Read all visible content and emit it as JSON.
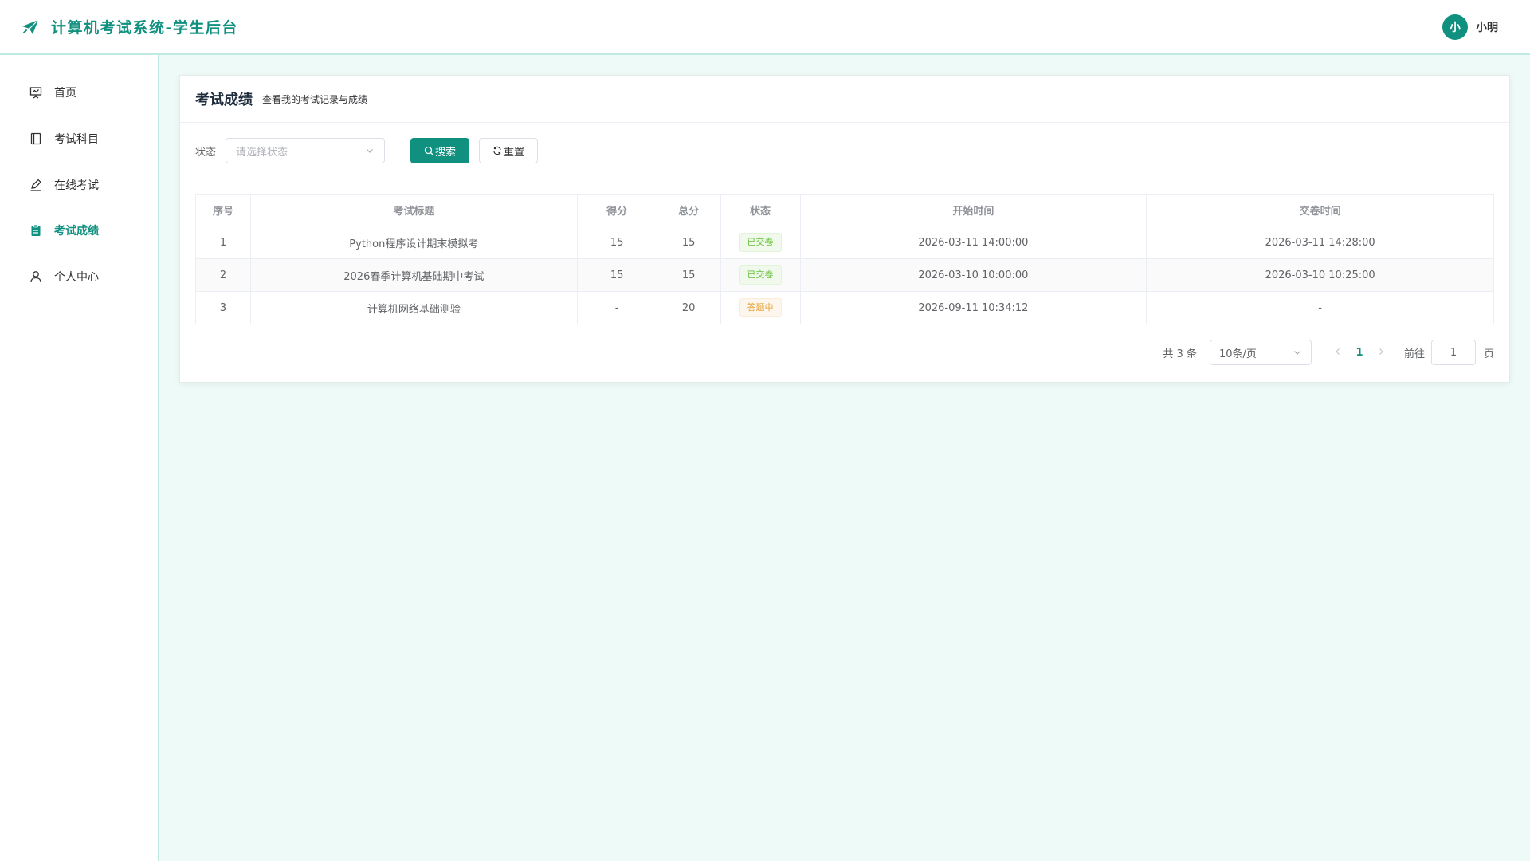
{
  "app": {
    "title": "计算机考试系统-学生后台",
    "user": {
      "avatar_text": "小",
      "name": "小明"
    }
  },
  "sidebar": {
    "items": [
      {
        "label": "首页",
        "icon": "presentation-icon",
        "active": false
      },
      {
        "label": "考试科目",
        "icon": "notebook-icon",
        "active": false
      },
      {
        "label": "在线考试",
        "icon": "edit-pen-icon",
        "active": false
      },
      {
        "label": "考试成绩",
        "icon": "clipboard-icon",
        "active": true
      },
      {
        "label": "个人中心",
        "icon": "user-icon",
        "active": false
      }
    ]
  },
  "page": {
    "title": "考试成绩",
    "subtitle": "查看我的考试记录与成绩"
  },
  "filter": {
    "status_label": "状态",
    "status_placeholder": "请选择状态",
    "search_label": "搜索",
    "reset_label": "重置"
  },
  "table": {
    "columns": [
      "序号",
      "考试标题",
      "得分",
      "总分",
      "状态",
      "开始时间",
      "交卷时间"
    ],
    "rows": [
      {
        "index": "1",
        "title": "Python程序设计期末模拟考",
        "score": "15",
        "total": "15",
        "status": "已交卷",
        "status_type": "success",
        "start": "2026-03-11 14:00:00",
        "submit": "2026-03-11 14:28:00"
      },
      {
        "index": "2",
        "title": "2026春季计算机基础期中考试",
        "score": "15",
        "total": "15",
        "status": "已交卷",
        "status_type": "success",
        "start": "2026-03-10 10:00:00",
        "submit": "2026-03-10 10:25:00"
      },
      {
        "index": "3",
        "title": "计算机网络基础测验",
        "score": "-",
        "total": "20",
        "status": "答题中",
        "status_type": "warning",
        "start": "2026-09-11 10:34:12",
        "submit": "-"
      }
    ]
  },
  "pagination": {
    "total_text": "共 3 条",
    "page_size": "10条/页",
    "current_page": "1",
    "goto_label": "前往",
    "goto_value": "1",
    "page_suffix": "页"
  },
  "colors": {
    "accent": "#10907f",
    "background": "#eefaf8"
  }
}
